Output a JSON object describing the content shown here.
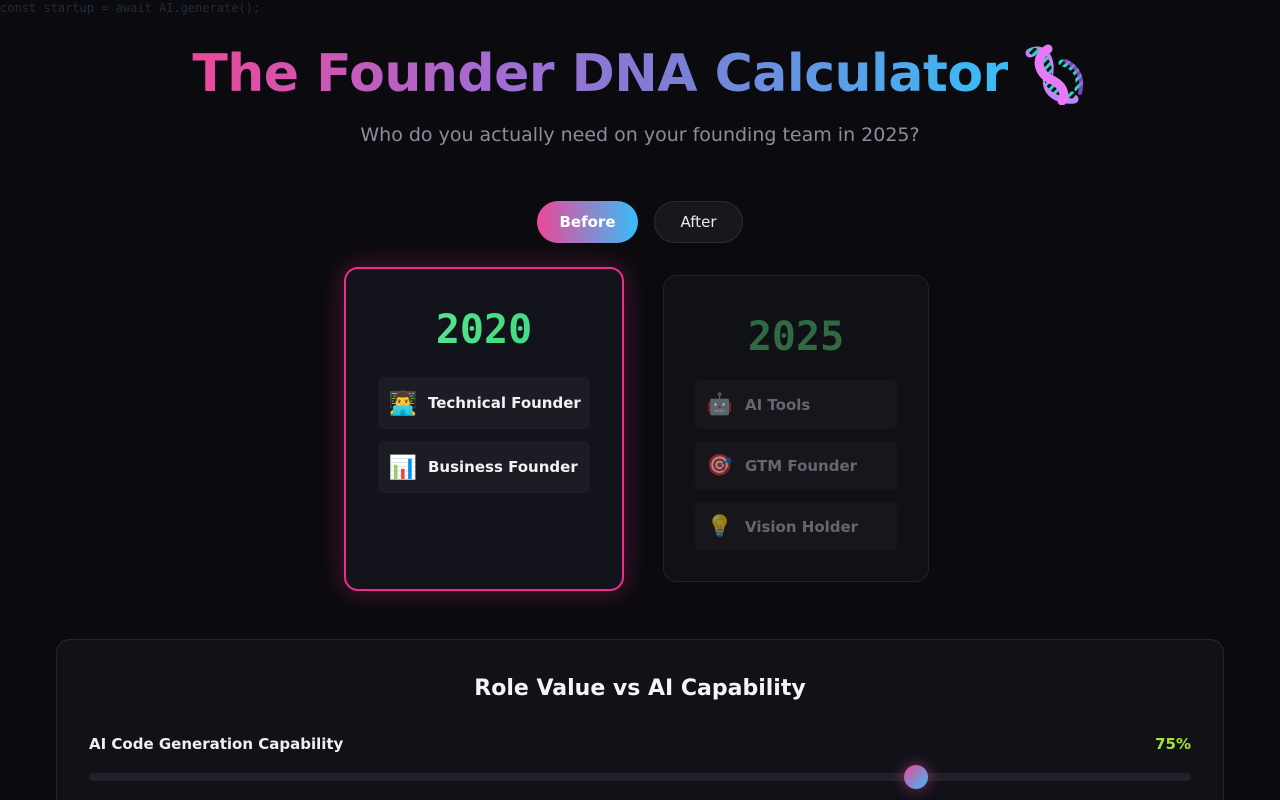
{
  "background_code": "const startup = await AI.generate();",
  "header": {
    "title": "The Founder DNA Calculator",
    "subtitle": "Who do you actually need on your founding team in 2025?",
    "icon": "dna-icon"
  },
  "toggle": {
    "before_label": "Before",
    "after_label": "After",
    "active": "Before"
  },
  "cards": {
    "before": {
      "year": "2020",
      "roles": [
        {
          "icon": "👨‍💻",
          "label": "Technical Founder"
        },
        {
          "icon": "📊",
          "label": "Business Founder"
        }
      ]
    },
    "after": {
      "year": "2025",
      "roles": [
        {
          "icon": "🤖",
          "label": "AI Tools"
        },
        {
          "icon": "🎯",
          "label": "GTM Founder"
        },
        {
          "icon": "💡",
          "label": "Vision Holder"
        }
      ]
    }
  },
  "panel": {
    "title": "Role Value vs AI Capability",
    "slider": {
      "label": "AI Code Generation Capability",
      "value_text": "75%",
      "value": 75
    }
  },
  "colors": {
    "accent_pink": "#ec4899",
    "accent_blue": "#38bdf8",
    "accent_green": "#4ade80",
    "value_lime": "#a3e635"
  }
}
